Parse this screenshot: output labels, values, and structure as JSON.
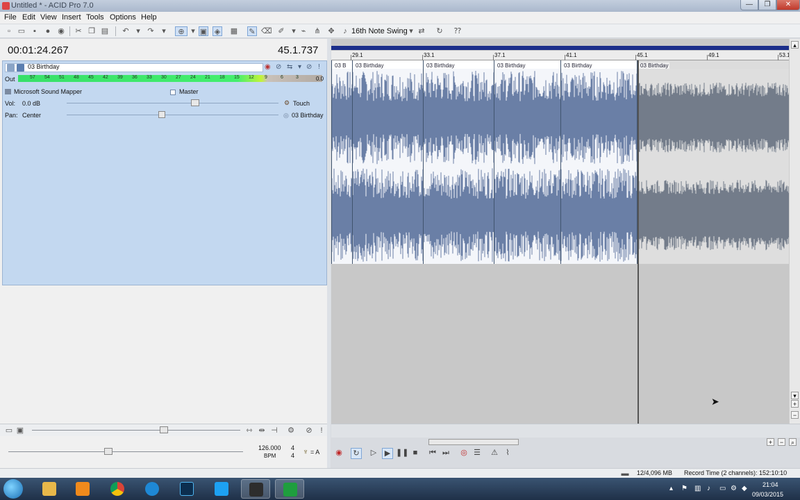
{
  "window": {
    "title": "Untitled * - ACID Pro 7.0"
  },
  "menu": [
    "File",
    "Edit",
    "View",
    "Insert",
    "Tools",
    "Options",
    "Help"
  ],
  "toolbar": {
    "swing_label": "16th Note Swing"
  },
  "display": {
    "time": "00:01:24.267",
    "measure": "45.1.737"
  },
  "track": {
    "name": "03 Birthday",
    "out_label": "Out",
    "meter_ticks": [
      "57",
      "54",
      "51",
      "48",
      "45",
      "42",
      "39",
      "36",
      "33",
      "30",
      "27",
      "24",
      "21",
      "18",
      "15",
      "12",
      "9",
      "6",
      "3"
    ],
    "meter_end": "0.0",
    "device": "Microsoft Sound Mapper",
    "master": "Master",
    "vol_label": "Vol:",
    "vol_value": "0.0 dB",
    "automation_mode": "Touch",
    "pan_label": "Pan:",
    "pan_value": "Center",
    "clip_ref": "03 Birthday"
  },
  "ruler": [
    "29.1",
    "33.1",
    "37.1",
    "41.1",
    "45.1",
    "49.1",
    "53.1"
  ],
  "clips": [
    {
      "label": "03 B"
    },
    {
      "label": "03 Birthday"
    },
    {
      "label": "03 Birthday"
    },
    {
      "label": "03 Birthday"
    },
    {
      "label": "03 Birthday"
    },
    {
      "label": "03 Birthday"
    }
  ],
  "tempo": {
    "bpm": "126.000",
    "bpm_label": "BPM",
    "sig_top": "4",
    "sig_bottom": "4",
    "key": "= A"
  },
  "status": {
    "memory": "12/4,096 MB",
    "record_time": "Record Time (2 channels): 152:10:10"
  },
  "clock": {
    "time": "21:04",
    "date": "09/03/2015"
  },
  "colors": {
    "track_bg": "#c3d8f0",
    "waveform": "#6a7fa6",
    "loop_bar": "#1b2e8a",
    "meter": "#44ef6e"
  }
}
